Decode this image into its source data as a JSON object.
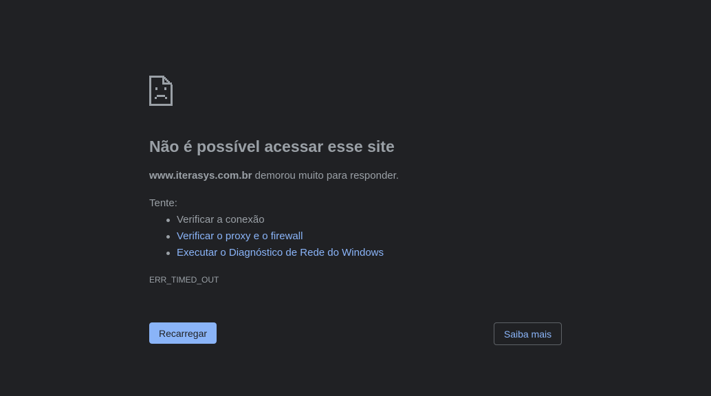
{
  "error": {
    "icon": "sad-page-icon",
    "title": "Não é possível acessar esse site",
    "host": "www.iterasys.com.br",
    "summary_suffix": " demorou muito para responder.",
    "try_label": "Tente:",
    "suggestions": [
      {
        "label": "Verificar a conexão",
        "link": false
      },
      {
        "label": "Verificar o proxy e o firewall",
        "link": true
      },
      {
        "label": "Executar o Diagnóstico de Rede do Windows",
        "link": true
      }
    ],
    "code": "ERR_TIMED_OUT"
  },
  "buttons": {
    "reload_label": "Recarregar",
    "details_label": "Saiba mais"
  },
  "colors": {
    "background": "#202124",
    "text": "#9aa0a6",
    "link": "#8ab4f8",
    "primary_button": "#8ab4f8"
  }
}
